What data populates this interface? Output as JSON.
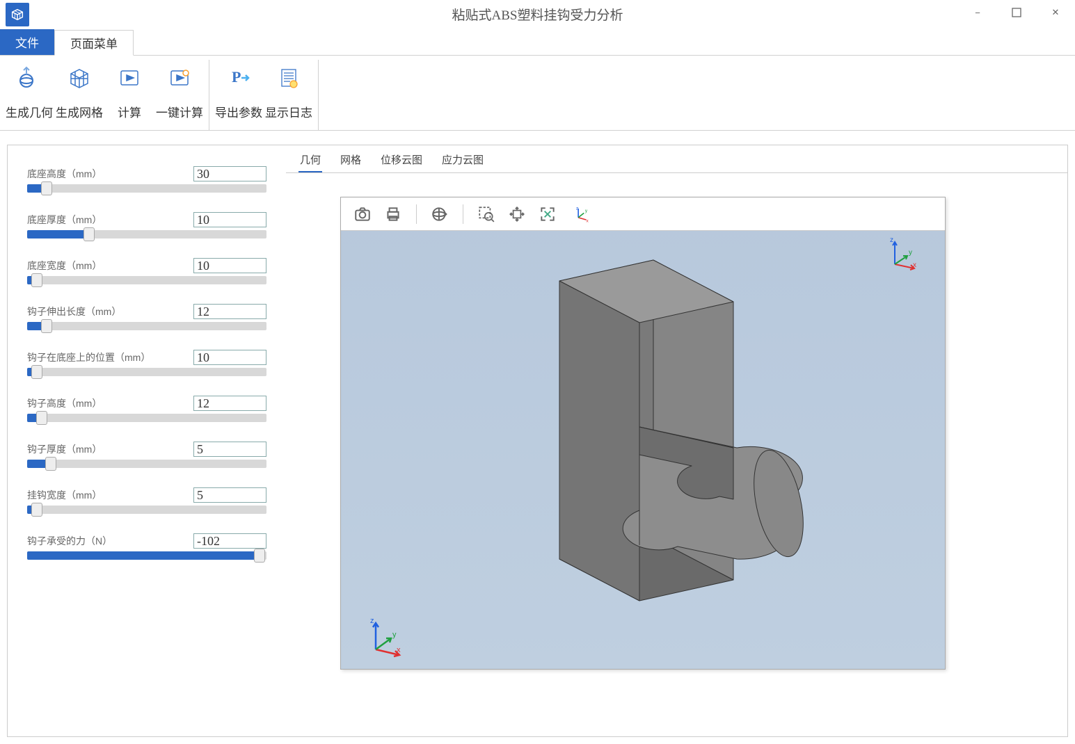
{
  "title": "粘贴式ABS塑料挂钩受力分析",
  "app_icon": "app-logo",
  "window_controls": {
    "minimize": "−",
    "maximize": "□",
    "close": "✕"
  },
  "menu": {
    "file": "文件",
    "page": "页面菜单"
  },
  "ribbon": {
    "group1": [
      {
        "icon": "geometry-icon",
        "label": "生成几何"
      },
      {
        "icon": "mesh-icon",
        "label": "生成网格"
      },
      {
        "icon": "compute-icon",
        "label": "计算"
      },
      {
        "icon": "one-click-icon",
        "label": "一键计算"
      }
    ],
    "group2": [
      {
        "icon": "export-icon",
        "label": "导出参数"
      },
      {
        "icon": "log-icon",
        "label": "显示日志"
      }
    ]
  },
  "params": [
    {
      "label": "底座高度（mm）",
      "value": "30",
      "pct": 8
    },
    {
      "label": "底座厚度（mm）",
      "value": "10",
      "pct": 26
    },
    {
      "label": "底座宽度（mm）",
      "value": "10",
      "pct": 4
    },
    {
      "label": "钩子伸出长度（mm）",
      "value": "12",
      "pct": 8
    },
    {
      "label": "钩子在底座上的位置（mm）",
      "value": "10",
      "pct": 4
    },
    {
      "label": "钩子高度（mm）",
      "value": "12",
      "pct": 6
    },
    {
      "label": "钩子厚度（mm）",
      "value": "5",
      "pct": 10
    },
    {
      "label": "挂钩宽度（mm）",
      "value": "5",
      "pct": 4
    },
    {
      "label": "钩子承受的力（N）",
      "value": "-102",
      "pct": 97
    }
  ],
  "view_tabs": [
    {
      "label": "几何",
      "active": true
    },
    {
      "label": "网格",
      "active": false
    },
    {
      "label": "位移云图",
      "active": false
    },
    {
      "label": "应力云图",
      "active": false
    }
  ],
  "canvas_tools": [
    "camera-icon",
    "print-icon",
    "sep",
    "sphere-icon",
    "sep",
    "zoom-select-icon",
    "pan-icon",
    "fit-icon",
    "axis-xyz-icon"
  ]
}
